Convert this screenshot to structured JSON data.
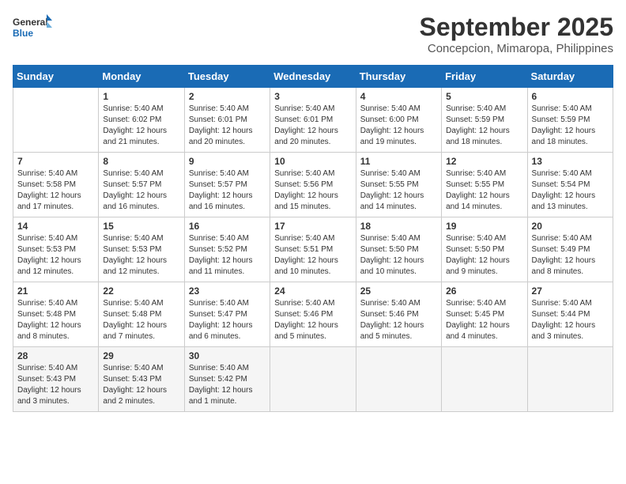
{
  "header": {
    "logo_line1": "General",
    "logo_line2": "Blue",
    "month": "September 2025",
    "location": "Concepcion, Mimaropa, Philippines"
  },
  "days_of_week": [
    "Sunday",
    "Monday",
    "Tuesday",
    "Wednesday",
    "Thursday",
    "Friday",
    "Saturday"
  ],
  "weeks": [
    [
      {
        "day": "",
        "info": ""
      },
      {
        "day": "1",
        "info": "Sunrise: 5:40 AM\nSunset: 6:02 PM\nDaylight: 12 hours\nand 21 minutes."
      },
      {
        "day": "2",
        "info": "Sunrise: 5:40 AM\nSunset: 6:01 PM\nDaylight: 12 hours\nand 20 minutes."
      },
      {
        "day": "3",
        "info": "Sunrise: 5:40 AM\nSunset: 6:01 PM\nDaylight: 12 hours\nand 20 minutes."
      },
      {
        "day": "4",
        "info": "Sunrise: 5:40 AM\nSunset: 6:00 PM\nDaylight: 12 hours\nand 19 minutes."
      },
      {
        "day": "5",
        "info": "Sunrise: 5:40 AM\nSunset: 5:59 PM\nDaylight: 12 hours\nand 18 minutes."
      },
      {
        "day": "6",
        "info": "Sunrise: 5:40 AM\nSunset: 5:59 PM\nDaylight: 12 hours\nand 18 minutes."
      }
    ],
    [
      {
        "day": "7",
        "info": "Sunrise: 5:40 AM\nSunset: 5:58 PM\nDaylight: 12 hours\nand 17 minutes."
      },
      {
        "day": "8",
        "info": "Sunrise: 5:40 AM\nSunset: 5:57 PM\nDaylight: 12 hours\nand 16 minutes."
      },
      {
        "day": "9",
        "info": "Sunrise: 5:40 AM\nSunset: 5:57 PM\nDaylight: 12 hours\nand 16 minutes."
      },
      {
        "day": "10",
        "info": "Sunrise: 5:40 AM\nSunset: 5:56 PM\nDaylight: 12 hours\nand 15 minutes."
      },
      {
        "day": "11",
        "info": "Sunrise: 5:40 AM\nSunset: 5:55 PM\nDaylight: 12 hours\nand 14 minutes."
      },
      {
        "day": "12",
        "info": "Sunrise: 5:40 AM\nSunset: 5:55 PM\nDaylight: 12 hours\nand 14 minutes."
      },
      {
        "day": "13",
        "info": "Sunrise: 5:40 AM\nSunset: 5:54 PM\nDaylight: 12 hours\nand 13 minutes."
      }
    ],
    [
      {
        "day": "14",
        "info": "Sunrise: 5:40 AM\nSunset: 5:53 PM\nDaylight: 12 hours\nand 12 minutes."
      },
      {
        "day": "15",
        "info": "Sunrise: 5:40 AM\nSunset: 5:53 PM\nDaylight: 12 hours\nand 12 minutes."
      },
      {
        "day": "16",
        "info": "Sunrise: 5:40 AM\nSunset: 5:52 PM\nDaylight: 12 hours\nand 11 minutes."
      },
      {
        "day": "17",
        "info": "Sunrise: 5:40 AM\nSunset: 5:51 PM\nDaylight: 12 hours\nand 10 minutes."
      },
      {
        "day": "18",
        "info": "Sunrise: 5:40 AM\nSunset: 5:50 PM\nDaylight: 12 hours\nand 10 minutes."
      },
      {
        "day": "19",
        "info": "Sunrise: 5:40 AM\nSunset: 5:50 PM\nDaylight: 12 hours\nand 9 minutes."
      },
      {
        "day": "20",
        "info": "Sunrise: 5:40 AM\nSunset: 5:49 PM\nDaylight: 12 hours\nand 8 minutes."
      }
    ],
    [
      {
        "day": "21",
        "info": "Sunrise: 5:40 AM\nSunset: 5:48 PM\nDaylight: 12 hours\nand 8 minutes."
      },
      {
        "day": "22",
        "info": "Sunrise: 5:40 AM\nSunset: 5:48 PM\nDaylight: 12 hours\nand 7 minutes."
      },
      {
        "day": "23",
        "info": "Sunrise: 5:40 AM\nSunset: 5:47 PM\nDaylight: 12 hours\nand 6 minutes."
      },
      {
        "day": "24",
        "info": "Sunrise: 5:40 AM\nSunset: 5:46 PM\nDaylight: 12 hours\nand 5 minutes."
      },
      {
        "day": "25",
        "info": "Sunrise: 5:40 AM\nSunset: 5:46 PM\nDaylight: 12 hours\nand 5 minutes."
      },
      {
        "day": "26",
        "info": "Sunrise: 5:40 AM\nSunset: 5:45 PM\nDaylight: 12 hours\nand 4 minutes."
      },
      {
        "day": "27",
        "info": "Sunrise: 5:40 AM\nSunset: 5:44 PM\nDaylight: 12 hours\nand 3 minutes."
      }
    ],
    [
      {
        "day": "28",
        "info": "Sunrise: 5:40 AM\nSunset: 5:43 PM\nDaylight: 12 hours\nand 3 minutes."
      },
      {
        "day": "29",
        "info": "Sunrise: 5:40 AM\nSunset: 5:43 PM\nDaylight: 12 hours\nand 2 minutes."
      },
      {
        "day": "30",
        "info": "Sunrise: 5:40 AM\nSunset: 5:42 PM\nDaylight: 12 hours\nand 1 minute."
      },
      {
        "day": "",
        "info": ""
      },
      {
        "day": "",
        "info": ""
      },
      {
        "day": "",
        "info": ""
      },
      {
        "day": "",
        "info": ""
      }
    ]
  ]
}
